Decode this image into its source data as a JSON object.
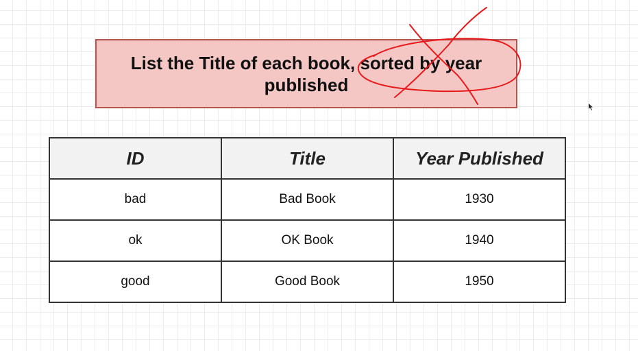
{
  "question": {
    "text": "List the Title of each book, sorted by year published"
  },
  "table": {
    "headers": [
      "ID",
      "Title",
      "Year Published"
    ],
    "rows": [
      [
        "bad",
        "Bad Book",
        "1930"
      ],
      [
        "ok",
        "OK Book",
        "1940"
      ],
      [
        "good",
        "Good Book",
        "1950"
      ]
    ]
  },
  "colors": {
    "question_fill": "#f4c7c4",
    "question_border": "#b85450",
    "annotation_ink": "#e8191b",
    "header_fill": "#f2f2f2"
  },
  "annotation": {
    "type": "hand-drawn-circle-and-cross",
    "target_phrase": "sorted by year"
  }
}
